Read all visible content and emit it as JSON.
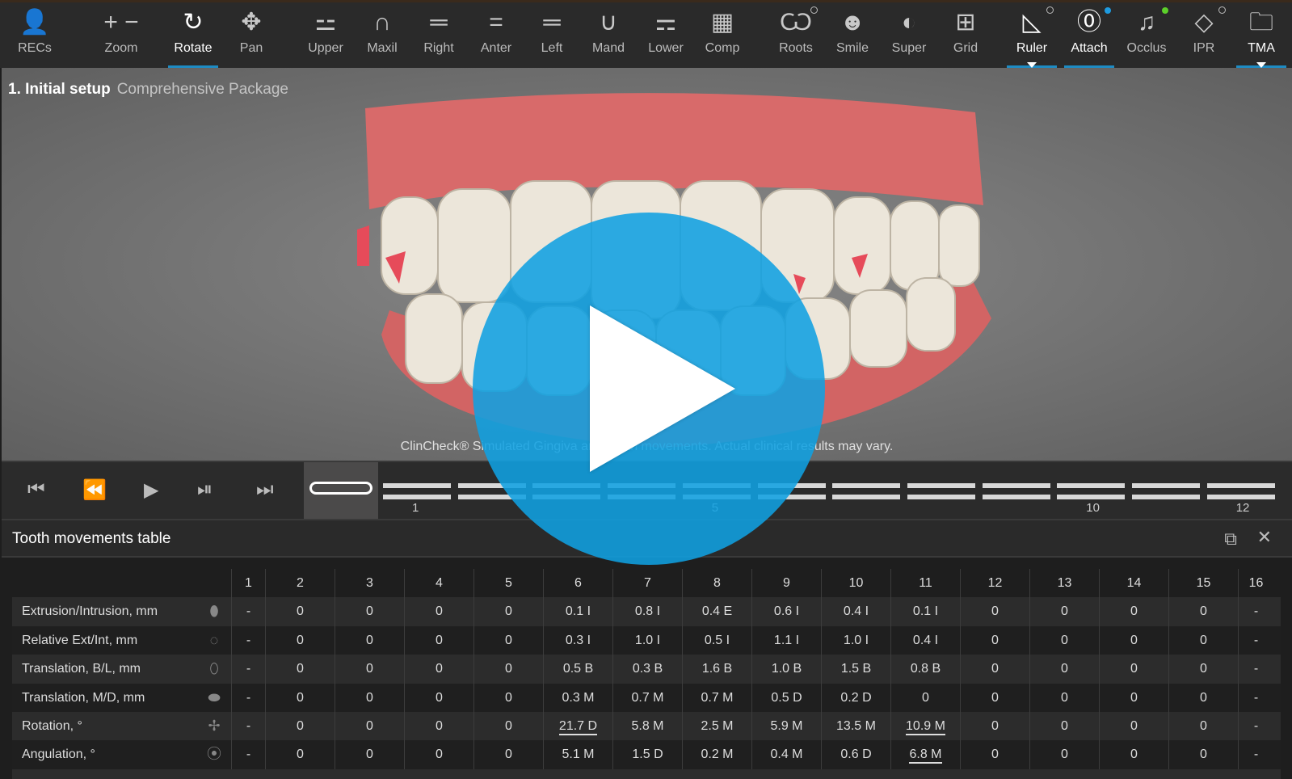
{
  "toolbar": {
    "tools": [
      {
        "id": "recs",
        "label": "RECs",
        "icon": "person-icon",
        "glyph": "👤"
      },
      {
        "id": "zoom",
        "label": "Zoom",
        "icon": "zoom-plus-minus-icon",
        "glyph": "+ −"
      },
      {
        "id": "rotate",
        "label": "Rotate",
        "icon": "rotate-icon",
        "glyph": "↻",
        "active": true,
        "underline": true
      },
      {
        "id": "pan",
        "label": "Pan",
        "icon": "pan-arrows-icon",
        "glyph": "✥"
      },
      {
        "id": "upper",
        "label": "Upper",
        "icon": "upper-view-icon",
        "glyph": "⚍"
      },
      {
        "id": "maxil",
        "label": "Maxil",
        "icon": "maxillary-arch-icon",
        "glyph": "∩"
      },
      {
        "id": "right",
        "label": "Right",
        "icon": "right-view-icon",
        "glyph": "═"
      },
      {
        "id": "anter",
        "label": "Anter",
        "icon": "anterior-view-icon",
        "glyph": "="
      },
      {
        "id": "left",
        "label": "Left",
        "icon": "left-view-icon",
        "glyph": "═"
      },
      {
        "id": "mand",
        "label": "Mand",
        "icon": "mandibular-arch-icon",
        "glyph": "∪"
      },
      {
        "id": "lower",
        "label": "Lower",
        "icon": "lower-view-icon",
        "glyph": "⚎"
      },
      {
        "id": "comp",
        "label": "Comp",
        "icon": "compare-grid-icon",
        "glyph": "▦"
      },
      {
        "id": "roots",
        "label": "Roots",
        "icon": "tooth-root-icon",
        "glyph": "Ѡ",
        "ring": true
      },
      {
        "id": "smile",
        "label": "Smile",
        "icon": "smile-face-icon",
        "glyph": "☻"
      },
      {
        "id": "super",
        "label": "Super",
        "icon": "superimpose-icon",
        "glyph": "◐"
      },
      {
        "id": "grid",
        "label": "Grid",
        "icon": "grid-icon",
        "glyph": "⊞"
      },
      {
        "id": "ruler",
        "label": "Ruler",
        "icon": "ruler-triangle-icon",
        "glyph": "◺",
        "ring": true,
        "active": true,
        "underline": true,
        "caret": true
      },
      {
        "id": "attach",
        "label": "Attach",
        "icon": "attachment-icon",
        "glyph": "⓪",
        "dot": "#1e9be0",
        "active": true,
        "underline": true
      },
      {
        "id": "occlus",
        "label": "Occlus",
        "icon": "occlusion-icon",
        "glyph": "♫",
        "dot": "#5ccf2a"
      },
      {
        "id": "ipr",
        "label": "IPR",
        "icon": "ipr-diamond-icon",
        "glyph": "◇",
        "ring": true
      },
      {
        "id": "tma",
        "label": "TMA",
        "icon": "folder-icon",
        "glyph": "🗀",
        "active": true,
        "underline": true,
        "caret": true
      }
    ]
  },
  "viewport": {
    "stage_number": "1. Initial setup",
    "package": "Comprehensive Package",
    "disclaimer": "ClinCheck® Simulated Gingiva and Tooth movements. Actual clinical results may vary."
  },
  "timeline": {
    "ticks": [
      {
        "stage": 1,
        "label": "1"
      },
      {
        "stage": 5,
        "label": "5"
      },
      {
        "stage": 10,
        "label": "10"
      },
      {
        "stage": 12,
        "label": "12"
      }
    ],
    "stages": 12,
    "current_stage": 0
  },
  "table": {
    "title": "Tooth movements table",
    "columns": [
      "1",
      "2",
      "3",
      "4",
      "5",
      "6",
      "7",
      "8",
      "9",
      "10",
      "11",
      "12",
      "13",
      "14",
      "15",
      "16"
    ],
    "rows": [
      {
        "label": "Extrusion/Intrusion, mm",
        "icon": "extrusion-tooth-icon",
        "values": [
          "-",
          "0",
          "0",
          "0",
          "0",
          "0.1 I",
          "0.8 I",
          "0.4 E",
          "0.6 I",
          "0.4 I",
          "0.1 I",
          "0",
          "0",
          "0",
          "0",
          "-"
        ],
        "underlined": []
      },
      {
        "label": "Relative Ext/Int, mm",
        "icon": "relative-extrusion-tooth-icon",
        "values": [
          "-",
          "0",
          "0",
          "0",
          "0",
          "0.3 I",
          "1.0 I",
          "0.5 I",
          "1.1 I",
          "1.0 I",
          "0.4 I",
          "0",
          "0",
          "0",
          "0",
          "-"
        ],
        "underlined": []
      },
      {
        "label": "Translation, B/L, mm",
        "icon": "translation-bl-tooth-icon",
        "values": [
          "-",
          "0",
          "0",
          "0",
          "0",
          "0.5 B",
          "0.3 B",
          "1.6 B",
          "1.0 B",
          "1.5 B",
          "0.8 B",
          "0",
          "0",
          "0",
          "0",
          "-"
        ],
        "underlined": []
      },
      {
        "label": "Translation, M/D, mm",
        "icon": "translation-md-tooth-icon",
        "values": [
          "-",
          "0",
          "0",
          "0",
          "0",
          "0.3 M",
          "0.7 M",
          "0.7 M",
          "0.5 D",
          "0.2 D",
          "0",
          "0",
          "0",
          "0",
          "0",
          "-"
        ],
        "underlined": []
      },
      {
        "label": "Rotation, °",
        "icon": "rotation-tooth-icon",
        "values": [
          "-",
          "0",
          "0",
          "0",
          "0",
          "21.7 D",
          "5.8 M",
          "2.5 M",
          "5.9 M",
          "13.5 M",
          "10.9 M",
          "0",
          "0",
          "0",
          "0",
          "-"
        ],
        "underlined": [
          5,
          10
        ]
      },
      {
        "label": "Angulation, °",
        "icon": "angulation-tooth-icon",
        "values": [
          "-",
          "0",
          "0",
          "0",
          "0",
          "5.1 M",
          "1.5 D",
          "0.2 M",
          "0.4 M",
          "0.6 D",
          "6.8 M",
          "0",
          "0",
          "0",
          "0",
          "-"
        ],
        "underlined": [
          10
        ]
      }
    ]
  },
  "colors": {
    "accent": "#1e8bc3",
    "play_overlay": "#10a0e1",
    "gum": "#d86a6a",
    "tooth": "#ece6da"
  }
}
